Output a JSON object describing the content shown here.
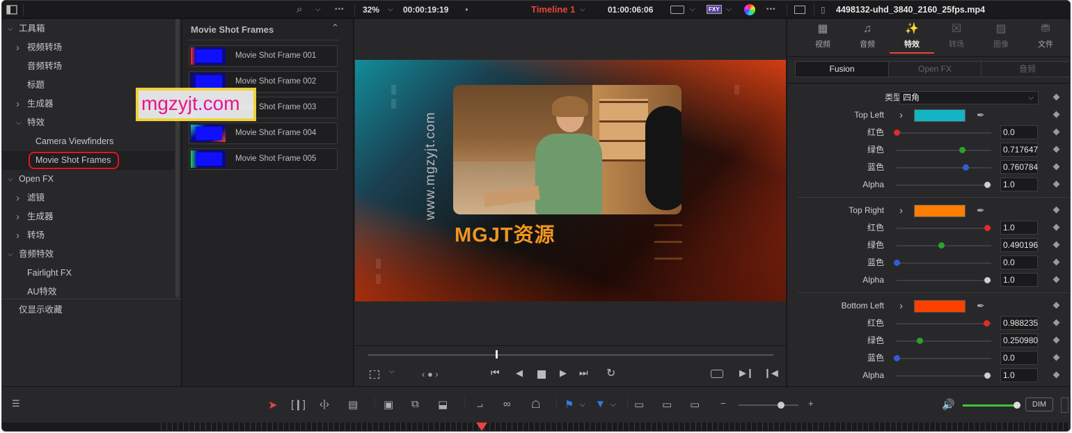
{
  "topbar": {
    "zoom": "32%",
    "timecode_left": "00:00:19:19",
    "timeline_name": "Timeline 1",
    "timecode_right": "01:00:06:06",
    "filename": "4498132-uhd_3840_2160_25fps.mp4",
    "fxy_label": "FXY",
    "more_dots": "•••"
  },
  "toolbox_tree": [
    {
      "label": "工具箱",
      "arrow": "down",
      "indent": 0
    },
    {
      "label": "视频转场",
      "arrow": "right",
      "indent": 1
    },
    {
      "label": "音频转场",
      "arrow": "",
      "indent": 1
    },
    {
      "label": "标题",
      "arrow": "",
      "indent": 1
    },
    {
      "label": "生成器",
      "arrow": "right",
      "indent": 1
    },
    {
      "label": "特效",
      "arrow": "down",
      "indent": 1
    },
    {
      "label": "Camera Viewfinders",
      "arrow": "",
      "indent": 2
    },
    {
      "label": "Movie Shot Frames",
      "arrow": "",
      "indent": 2
    },
    {
      "label": "Open FX",
      "arrow": "down",
      "indent": 0
    },
    {
      "label": "滤镜",
      "arrow": "right",
      "indent": 1
    },
    {
      "label": "生成器",
      "arrow": "right",
      "indent": 1
    },
    {
      "label": "转场",
      "arrow": "right",
      "indent": 1
    },
    {
      "label": "音频特效",
      "arrow": "down",
      "indent": 0
    },
    {
      "label": "Fairlight FX",
      "arrow": "",
      "indent": 1
    },
    {
      "label": "AU特效",
      "arrow": "",
      "indent": 1
    }
  ],
  "favorites_label": "仅显示收藏",
  "watermark": "mgzyjt.com",
  "browser": {
    "title": "Movie Shot Frames",
    "clips": [
      "Movie Shot Frame 001",
      "Movie Shot Frame 002",
      "Movie Shot Frame 003",
      "Movie Shot Frame 004",
      "Movie Shot Frame 005"
    ]
  },
  "viewer_overlay": {
    "vertical_text": "www.mgzyjt.com",
    "brand_text": "MGJT资源"
  },
  "inspector": {
    "tabs": [
      "视频",
      "音频",
      "特效",
      "转场",
      "图像",
      "文件"
    ],
    "active_tab": "特效",
    "subtabs": [
      "Fusion",
      "Open FX",
      "音频"
    ],
    "type_label": "类型",
    "type_value": "四角",
    "groups": [
      {
        "name": "Top Left",
        "color": "#13b4c4",
        "channels": [
          {
            "label": "红色",
            "value": "0.0",
            "pos": 0.0,
            "knob": "#e22b2b"
          },
          {
            "label": "绿色",
            "value": "0.717647",
            "pos": 0.72,
            "knob": "#2aa32a"
          },
          {
            "label": "蓝色",
            "value": "0.760784",
            "pos": 0.76,
            "knob": "#2f5ed8"
          },
          {
            "label": "Alpha",
            "value": "1.0",
            "pos": 1.0,
            "knob": "#cfcfcf"
          }
        ]
      },
      {
        "name": "Top Right",
        "color": "#ff7d00",
        "channels": [
          {
            "label": "红色",
            "value": "1.0",
            "pos": 1.0,
            "knob": "#e22b2b"
          },
          {
            "label": "绿色",
            "value": "0.490196",
            "pos": 0.49,
            "knob": "#2aa32a"
          },
          {
            "label": "蓝色",
            "value": "0.0",
            "pos": 0.0,
            "knob": "#2f5ed8"
          },
          {
            "label": "Alpha",
            "value": "1.0",
            "pos": 1.0,
            "knob": "#cfcfcf"
          }
        ]
      },
      {
        "name": "Bottom Left",
        "color": "#fc4000",
        "channels": [
          {
            "label": "红色",
            "value": "0.988235",
            "pos": 0.99,
            "knob": "#e22b2b"
          },
          {
            "label": "绿色",
            "value": "0.250980",
            "pos": 0.25,
            "knob": "#2aa32a"
          },
          {
            "label": "蓝色",
            "value": "0.0",
            "pos": 0.0,
            "knob": "#2f5ed8"
          },
          {
            "label": "Alpha",
            "value": "1.0",
            "pos": 1.0,
            "knob": "#cfcfcf"
          }
        ]
      }
    ]
  },
  "bottombar": {
    "dim_label": "DIM"
  },
  "colors": {
    "accent_red": "#e8453c",
    "highlight_outline": "#e8141c",
    "watermark_border": "#f0d23a",
    "watermark_text": "#e8148c",
    "brand_orange": "#f0961e",
    "volume_green": "#3cc83c"
  },
  "icons": [
    "panel-toggle-icon",
    "search-icon",
    "chevron-down-icon",
    "more-icon",
    "viewer-frame-icon",
    "fxy-icon",
    "color-wheel-icon",
    "image-icon",
    "video-tab-icon",
    "audio-tab-icon",
    "effects-wand-icon",
    "transition-tab-icon",
    "image-tab-icon",
    "file-tab-icon",
    "eyedropper-icon",
    "keyframe-diamond-icon",
    "play-icon",
    "stop-icon",
    "loop-icon",
    "volume-icon",
    "pointer-icon"
  ]
}
